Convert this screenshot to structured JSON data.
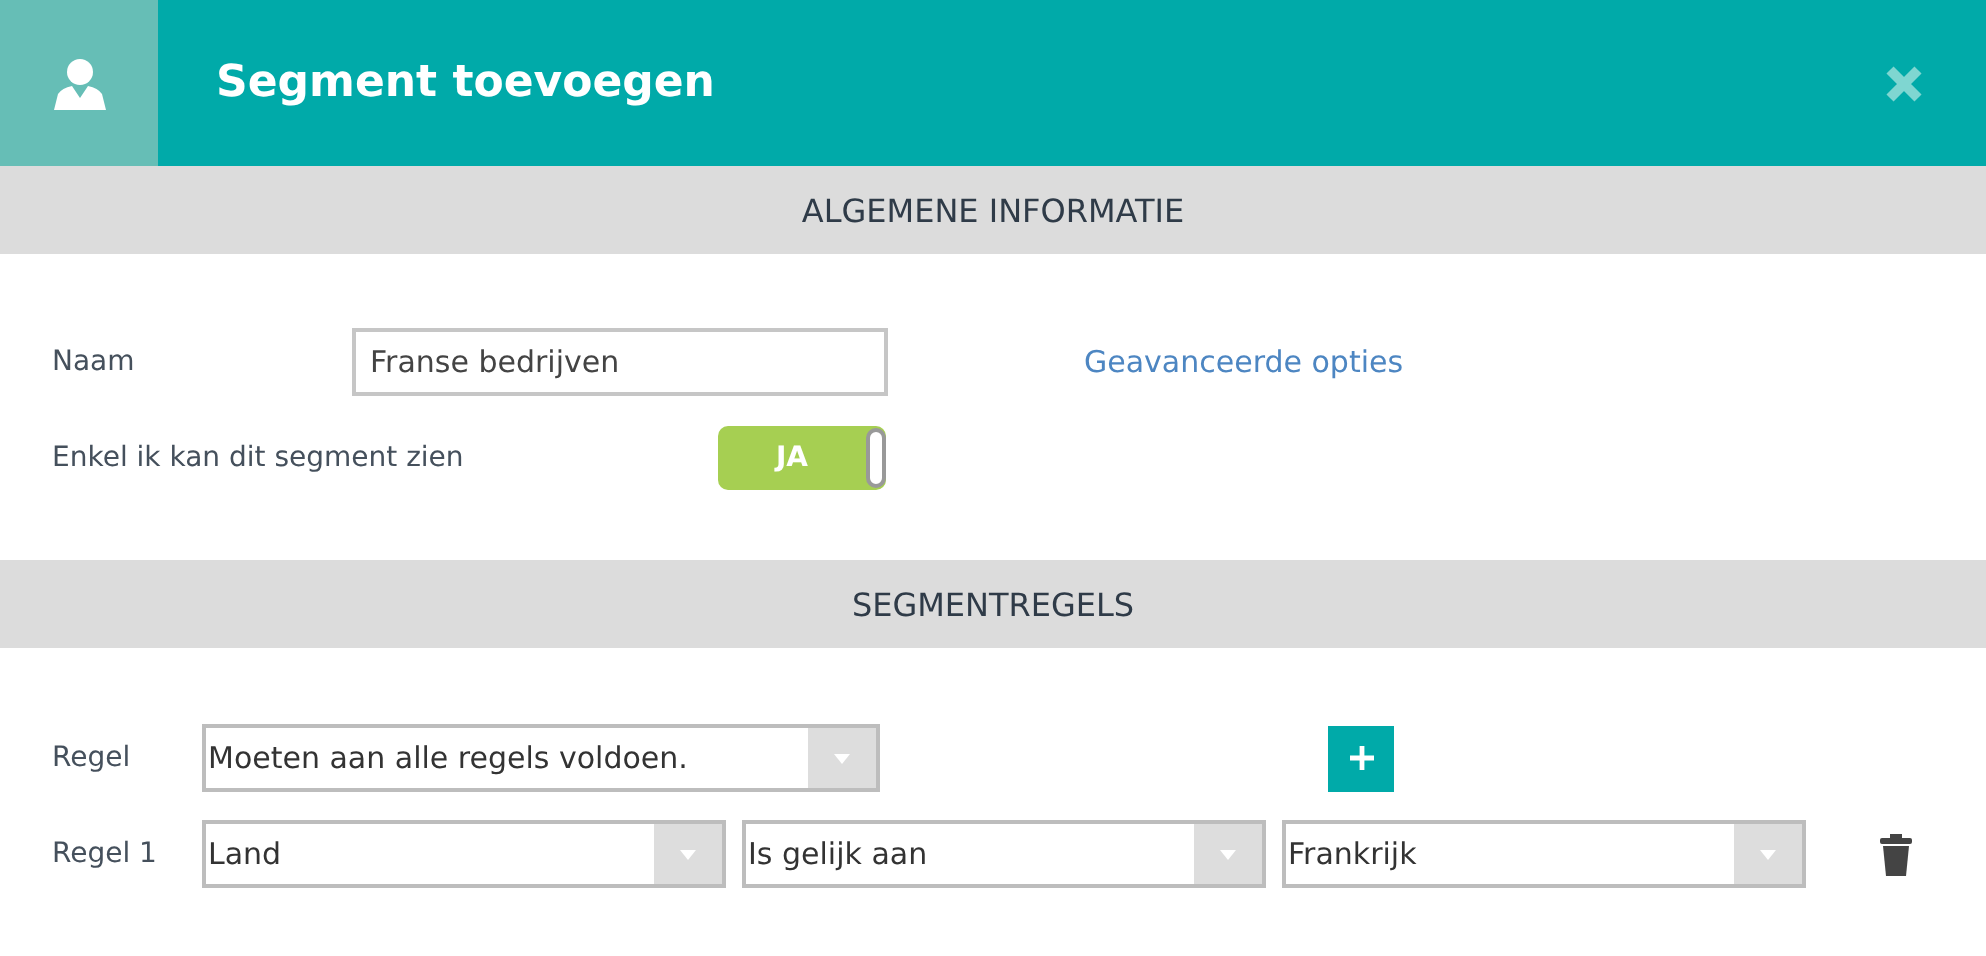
{
  "window": {
    "title": "Segment toevoegen"
  },
  "sections": [
    {
      "title": "ALGEMENE INFORMATIE"
    },
    {
      "title": "SEGMENTREGELS"
    }
  ],
  "general": {
    "name_label": "Naam",
    "name_value": "Franse bedrijven",
    "advanced_link": "Geavanceerde opties",
    "private_label": "Enkel ik kan dit segment zien",
    "private_toggle": {
      "label": "JA",
      "on": true
    }
  },
  "rules": {
    "match_label": "Regel",
    "match_value": "Moeten aan alle regels voldoen.",
    "rows": [
      {
        "label": "Regel 1",
        "field": "Land",
        "operator": "Is gelijk aan",
        "value": "Frankrijk"
      }
    ]
  }
}
